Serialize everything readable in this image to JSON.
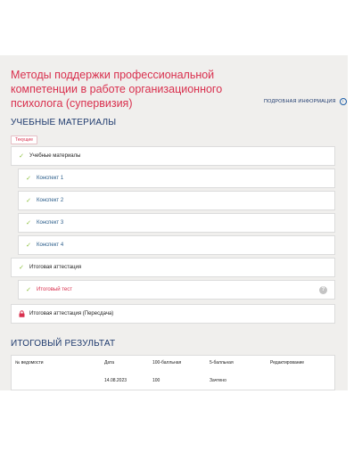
{
  "course": {
    "title": "Методы поддержки профессиональной компетенции в работе организационного психолога (супервизия)",
    "details_link": "ПОДРОБНАЯ ИНФОРМАЦИЯ",
    "details_icon": "chevron-right-icon"
  },
  "materials": {
    "heading": "УЧЕБНЫЕ МАТЕРИАЛЫ",
    "current_badge": "Текущие",
    "items": [
      {
        "label": "Учебные материалы",
        "status": "done"
      },
      {
        "label": "Конспект 1",
        "status": "done"
      },
      {
        "label": "Конспект 2",
        "status": "done"
      },
      {
        "label": "Конспект 3",
        "status": "done"
      },
      {
        "label": "Конспект 4",
        "status": "done"
      },
      {
        "label": "Итоговая аттестация",
        "status": "done"
      },
      {
        "label": "Итоговый тест",
        "status": "done"
      },
      {
        "label": "Итоговая аттестация (Пересдача)",
        "status": "locked"
      }
    ],
    "help_glyph": "?"
  },
  "results": {
    "heading": "ИТОГОВЫЙ РЕЗУЛЬТАТ",
    "columns": [
      "№ ведомости",
      "Дата",
      "100-балльная",
      "5-балльная",
      "Редактирование"
    ],
    "rows": [
      [
        "",
        "14.08.2023",
        "100",
        "Зачтено",
        ""
      ]
    ]
  },
  "colors": {
    "title": "#d9304e",
    "heading": "#1e3a6e",
    "check": "#8bbf3a",
    "lock": "#d9304e",
    "panel_bg": "#f0efed"
  }
}
